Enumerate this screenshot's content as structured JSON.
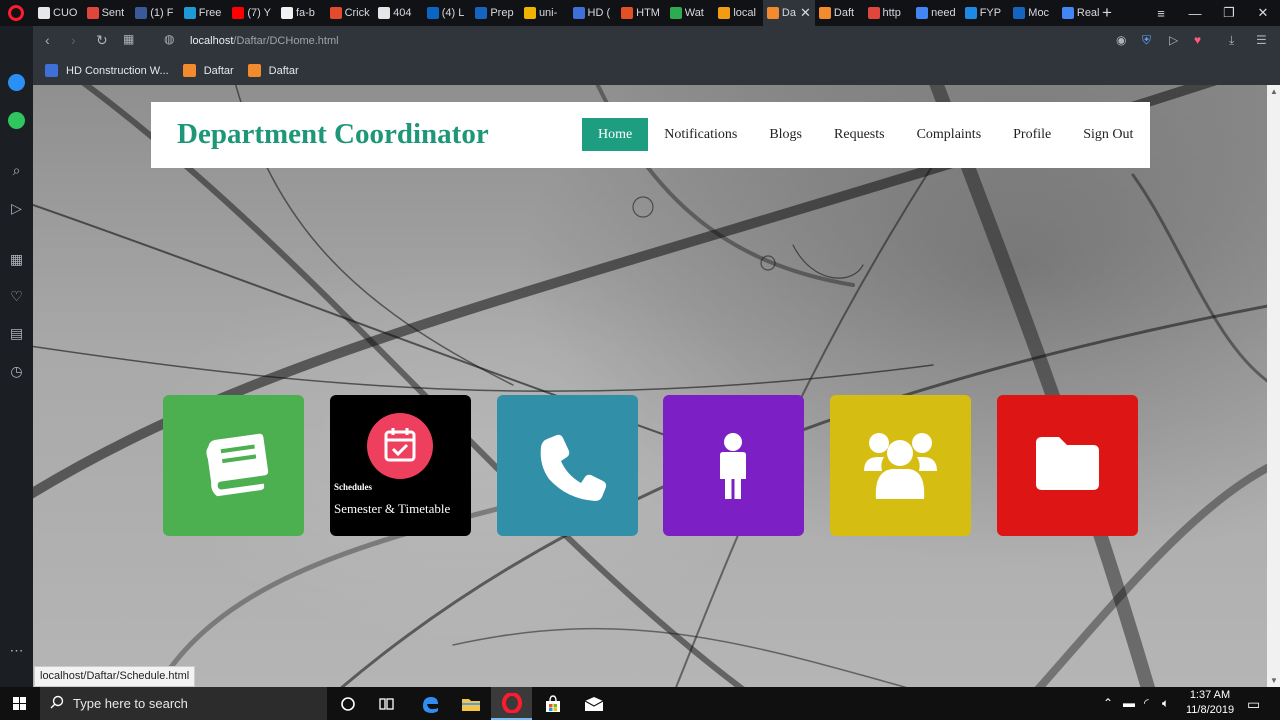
{
  "browser": {
    "tabs": [
      {
        "title": "CUO",
        "color": "#e5e7ea"
      },
      {
        "title": "Sent",
        "color": "#e0463c"
      },
      {
        "title": "(1) F",
        "color": "#3b5998"
      },
      {
        "title": "Free",
        "color": "#1e9ad6"
      },
      {
        "title": "(7) Y",
        "color": "#ff0000"
      },
      {
        "title": "fa-b",
        "color": "#f1f1f1"
      },
      {
        "title": "Crick",
        "color": "#e64a2e"
      },
      {
        "title": "404",
        "color": "#e6e6e6"
      },
      {
        "title": "(4) L",
        "color": "#0a66c2"
      },
      {
        "title": "Prep",
        "color": "#1565c0"
      },
      {
        "title": "uni-",
        "color": "#f0b400"
      },
      {
        "title": "HD (",
        "color": "#3f6fd8"
      },
      {
        "title": "HTM",
        "color": "#e34f26"
      },
      {
        "title": "Wat",
        "color": "#2eab4f"
      },
      {
        "title": "local",
        "color": "#f39c12"
      },
      {
        "title": "Da",
        "color": "#f28a2e",
        "active": true
      },
      {
        "title": "Daft",
        "color": "#f28a2e"
      },
      {
        "title": "http",
        "color": "#e0463c"
      },
      {
        "title": "need",
        "color": "#4285f4"
      },
      {
        "title": "FYP",
        "color": "#1e88e5"
      },
      {
        "title": "Moc",
        "color": "#1565c0"
      },
      {
        "title": "Real",
        "color": "#4285f4"
      }
    ],
    "url_host": "localhost",
    "url_path": "/Daftar/DCHome.html",
    "bookmarks": [
      {
        "label": "HD Construction W...",
        "color": "#3f6fd8"
      },
      {
        "label": "Daftar",
        "color": "#f28a2e"
      },
      {
        "label": "Daftar",
        "color": "#f28a2e"
      }
    ],
    "status_url": "localhost/Daftar/Schedule.html"
  },
  "site": {
    "title": "Department Coordinator",
    "nav": [
      {
        "label": "Home",
        "active": true
      },
      {
        "label": "Notifications"
      },
      {
        "label": "Blogs"
      },
      {
        "label": "Requests"
      },
      {
        "label": "Complaints"
      },
      {
        "label": "Profile"
      },
      {
        "label": "Sign Out"
      }
    ],
    "tiles": [
      {
        "icon": "book-icon",
        "color": "#4caf50"
      },
      {
        "icon": "calendar-check-icon",
        "color": "#000000",
        "subtitle": "Schedules",
        "title": "Semester & Timetable"
      },
      {
        "icon": "phone-icon",
        "color": "#318fa8"
      },
      {
        "icon": "person-icon",
        "color": "#7c1fc4"
      },
      {
        "icon": "users-icon",
        "color": "#d6bd12"
      },
      {
        "icon": "folder-icon",
        "color": "#dd1515"
      }
    ],
    "accent": "#1e9e80"
  },
  "taskbar": {
    "search_placeholder": "Type here to search",
    "time": "1:37 AM",
    "date": "11/8/2019"
  }
}
